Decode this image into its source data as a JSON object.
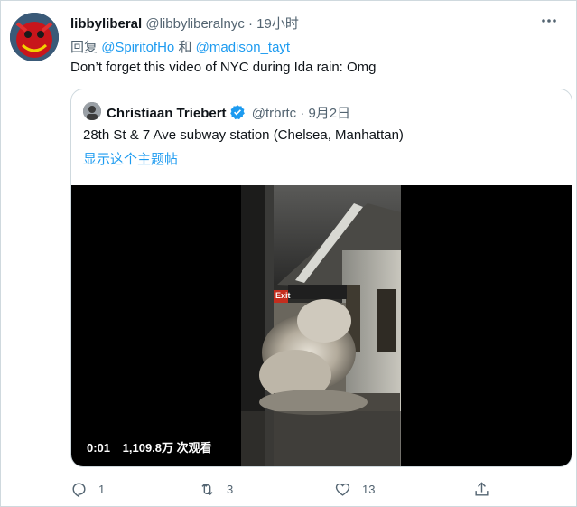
{
  "tweet": {
    "display_name": "libbyliberal",
    "handle": "@libbyliberalnyc",
    "separator": "·",
    "time": "19小时",
    "reply_prefix": "回复",
    "reply_user1": "@SpiritofHo",
    "reply_conj": "和",
    "reply_user2": "@madison_tayt",
    "text": "Don’t forget this video of NYC during Ida rain: Omg",
    "more_icon": "more-icon"
  },
  "quote": {
    "display_name": "Christiaan Triebert",
    "handle": "@trbrtc",
    "separator": "·",
    "date": "9月2日",
    "text": "28th St & 7 Ave subway station (Chelsea, Manhattan)",
    "show_thread": "显示这个主题帖",
    "video": {
      "time": "0:01",
      "views": "1,109.8万 次观看",
      "sign_exit": "Exit"
    }
  },
  "actions": {
    "reply_count": "1",
    "retweet_count": "3",
    "like_count": "13"
  },
  "colors": {
    "link": "#1d9bf0",
    "muted": "#536471",
    "verified": "#1d9bf0"
  }
}
